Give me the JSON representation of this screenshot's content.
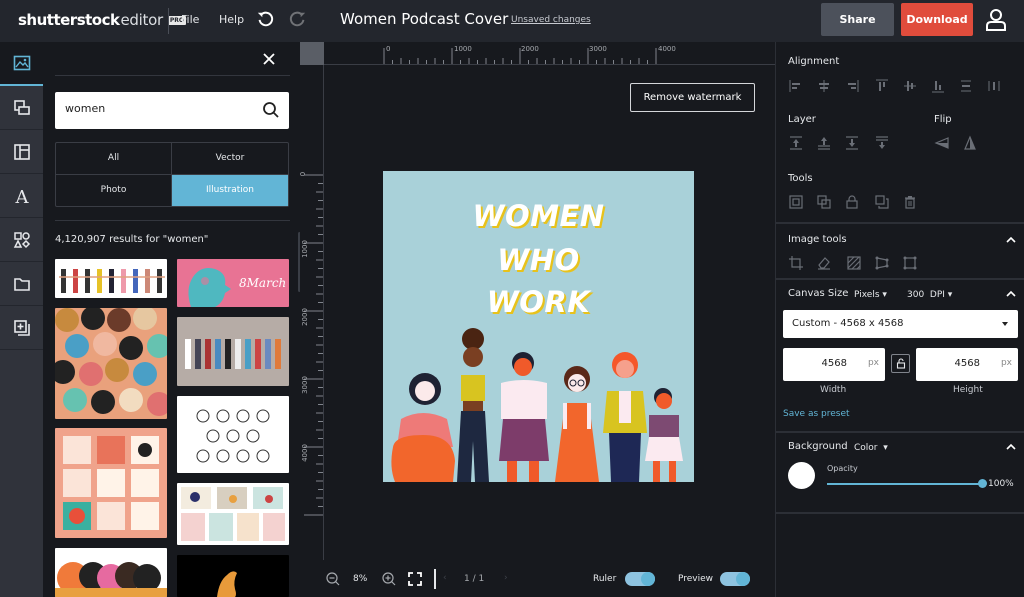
{
  "app": {
    "logo_bold": "shutterstock",
    "logo_light": "editor",
    "logo_badge": "PRO",
    "menu": [
      "File",
      "Help"
    ],
    "document_title": "Women Podcast Cover",
    "save_status": "Unsaved changes",
    "share_label": "Share",
    "download_label": "Download"
  },
  "sidebar": {
    "items": [
      {
        "icon": "image-icon",
        "active": true
      },
      {
        "icon": "layers-icon"
      },
      {
        "icon": "templates-icon"
      },
      {
        "icon": "text-icon"
      },
      {
        "icon": "shapes-icon"
      },
      {
        "icon": "folder-icon"
      },
      {
        "icon": "add-page-icon"
      }
    ]
  },
  "search_panel": {
    "query": "women",
    "placeholder": "Search",
    "filters": [
      {
        "label": "All",
        "active": false
      },
      {
        "label": "Vector",
        "active": false
      },
      {
        "label": "Photo",
        "active": false
      },
      {
        "label": "Illustration",
        "active": true
      }
    ],
    "results_text": "4,120,907 results for \"women\"",
    "thumbnails": [
      {
        "desc": "Women holding hands row",
        "bg": "#ffffff"
      },
      {
        "desc": "8 March women's day profile",
        "bg": "#e87394",
        "text": "8 March"
      },
      {
        "desc": "Crowd of diverse women pattern",
        "bg": "#e9a17c"
      },
      {
        "desc": "Women professions line-up",
        "bg": "#b6aca6"
      },
      {
        "desc": "Women line icons",
        "bg": "#ffffff"
      },
      {
        "desc": "Women's day card set",
        "bg": "#f0a38b"
      },
      {
        "desc": "Women illustration set",
        "bg": "#ffffff"
      },
      {
        "desc": "Women profiles colorful",
        "bg": "#ffffff"
      },
      {
        "desc": "Woman silhouette dark",
        "bg": "#000000"
      }
    ]
  },
  "workspace": {
    "ruler_top_labels": [
      "0",
      "1000",
      "2000",
      "3000",
      "4000"
    ],
    "ruler_left_labels": [
      "0",
      "1000",
      "2000",
      "3000",
      "4000"
    ],
    "watermark_button": "Remove watermark",
    "canvas": {
      "background": "#a9d1d9",
      "headline": [
        "WOMEN",
        "WHO",
        "WORK"
      ]
    },
    "zoom_level": "8%",
    "page_indicator": "1 / 1",
    "ruler_label": "Ruler",
    "ruler_on": true,
    "preview_label": "Preview",
    "preview_on": true
  },
  "properties": {
    "alignment_title": "Alignment",
    "layer_title": "Layer",
    "flip_title": "Flip",
    "tools_title": "Tools",
    "image_tools_title": "Image tools",
    "canvas_size_title": "Canvas Size",
    "unit": "Pixels",
    "dpi_value": "300",
    "dpi_label": "DPI",
    "preset": "Custom - 4568 x 4568",
    "width_value": "4568",
    "height_value": "4568",
    "unit_suffix": "px",
    "width_label": "Width",
    "height_label": "Height",
    "save_preset": "Save as preset",
    "background_title": "Background",
    "background_mode": "Color",
    "background_color": "#ffffff",
    "opacity_label": "Opacity",
    "opacity_value": "100%",
    "opacity_fraction": 1.0
  },
  "colors": {
    "accent": "#62b5d6",
    "download": "#e04c3c",
    "share": "#4c515b",
    "headline_shadow": "#e8c21b"
  }
}
